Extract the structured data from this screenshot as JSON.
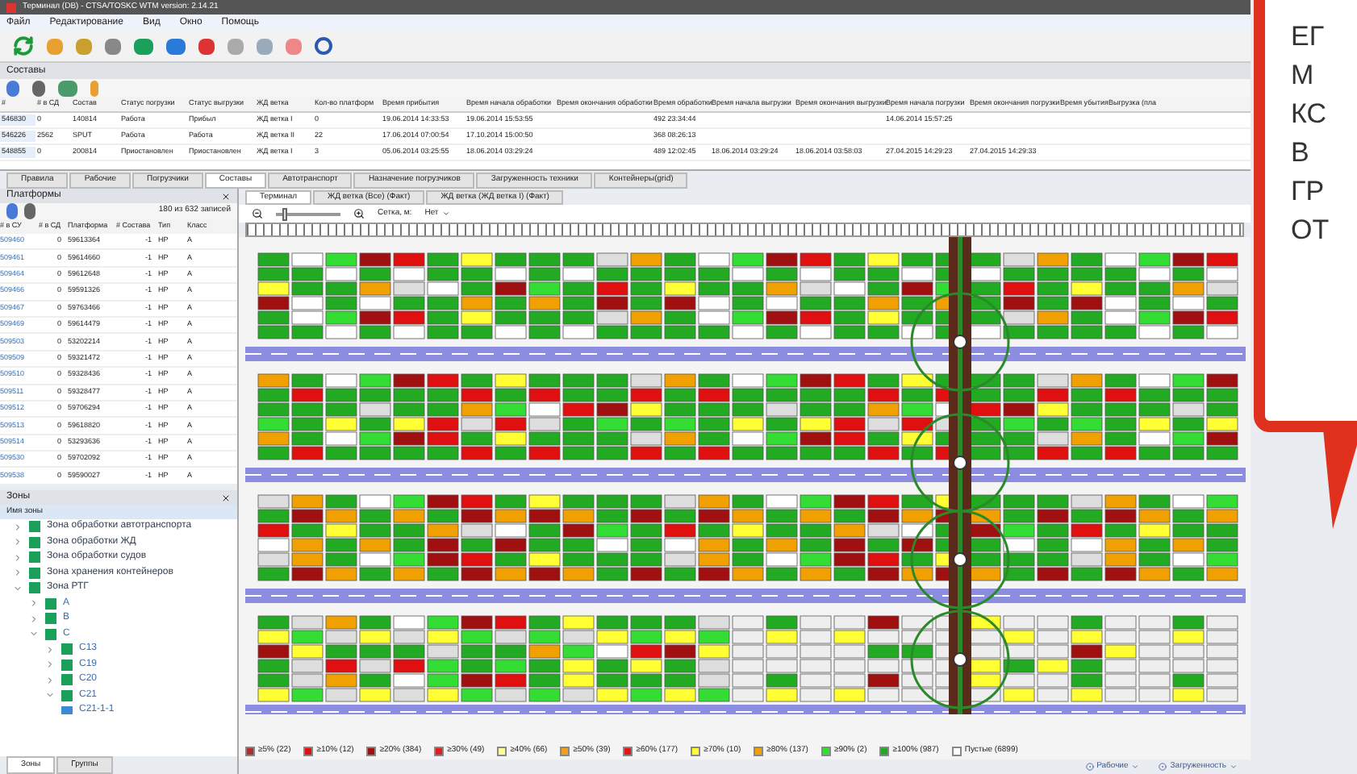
{
  "window": {
    "title": "Терминал (DB) - CTSA/TOSKC WTM version: 2.14.21"
  },
  "menu": [
    "Файл",
    "Редактирование",
    "Вид",
    "Окно",
    "Помощь"
  ],
  "trains": {
    "title": "Составы",
    "columns": [
      "#",
      "# в СД",
      "Состав",
      "Статус погрузки",
      "Статус выгрузки",
      "ЖД ветка",
      "Кол-во платформ",
      "Время прибытия",
      "Время начала обработки",
      "Время окончания обработки",
      "Время обработки",
      "Время начала выгрузки",
      "Время окончания выгрузки",
      "Время начала погрузки",
      "Время окончания погрузки",
      "Время убытия",
      "Выгрузка (пла"
    ],
    "rows": [
      [
        "546830",
        "0",
        "140814",
        "Работа",
        "Прибыл",
        "ЖД ветка I",
        "0",
        "19.06.2014 14:33:53",
        "19.06.2014 15:53:55",
        "",
        "492 23:34:44",
        "",
        "",
        "14.06.2014 15:57:25",
        "",
        "",
        ""
      ],
      [
        "546226",
        "2562",
        "SPUT",
        "Работа",
        "Работа",
        "ЖД ветка II",
        "22",
        "17.06.2014 07:00:54",
        "17.10.2014 15:00:50",
        "",
        "368 08:26:13",
        "",
        "",
        "",
        "",
        "",
        ""
      ],
      [
        "548855",
        "0",
        "200814",
        "Приостановлен",
        "Приостановлен",
        "ЖД ветка I",
        "3",
        "05.06.2014 03:25:55",
        "18.06.2014 03:29:24",
        "",
        "489 12:02:45",
        "18.06.2014 03:29:24",
        "18.06.2014 03:58:03",
        "27.04.2015 14:29:23",
        "27.04.2015 14:29:33",
        "",
        ""
      ]
    ]
  },
  "tabs": [
    {
      "label": "Правила",
      "selected": false
    },
    {
      "label": "Рабочие",
      "selected": false
    },
    {
      "label": "Погрузчики",
      "selected": false
    },
    {
      "label": "Составы",
      "selected": true
    },
    {
      "label": "Автотранспорт",
      "selected": false
    },
    {
      "label": "Назначение погрузчиков",
      "selected": false
    },
    {
      "label": "Загруженность техники",
      "selected": false
    },
    {
      "label": "Контейнеры(grid)",
      "selected": false
    }
  ],
  "platforms": {
    "title": "Платформы",
    "count": "180 из 632 записей",
    "columns": [
      "# в СУ",
      "# в СД",
      "Платформа",
      "# Состава",
      "Тип",
      "Класс"
    ],
    "rows": [
      [
        "509460",
        "0",
        "59613364",
        "-1",
        "НР",
        "А"
      ],
      [
        "509461",
        "0",
        "59614660",
        "-1",
        "НР",
        "А"
      ],
      [
        "509464",
        "0",
        "59612648",
        "-1",
        "НР",
        "А"
      ],
      [
        "509466",
        "0",
        "59591326",
        "-1",
        "НР",
        "А"
      ],
      [
        "509467",
        "0",
        "59763466",
        "-1",
        "НР",
        "А"
      ],
      [
        "509469",
        "0",
        "59614479",
        "-1",
        "НР",
        "А"
      ],
      [
        "509503",
        "0",
        "53202214",
        "-1",
        "НР",
        "А"
      ],
      [
        "509509",
        "0",
        "59321472",
        "-1",
        "НР",
        "А"
      ],
      [
        "509510",
        "0",
        "59328436",
        "-1",
        "НР",
        "А"
      ],
      [
        "509511",
        "0",
        "59328477",
        "-1",
        "НР",
        "А"
      ],
      [
        "509512",
        "0",
        "59706294",
        "-1",
        "НР",
        "А"
      ],
      [
        "509513",
        "0",
        "59618820",
        "-1",
        "НР",
        "А"
      ],
      [
        "509514",
        "0",
        "53293636",
        "-1",
        "НР",
        "А"
      ],
      [
        "509530",
        "0",
        "59702092",
        "-1",
        "НР",
        "А"
      ],
      [
        "509538",
        "0",
        "59590027",
        "-1",
        "НР",
        "А"
      ]
    ]
  },
  "zones": {
    "title": "Зоны",
    "column": "Имя зоны",
    "tree": [
      {
        "label": "Зона обработки автотранспорта",
        "expanded": false
      },
      {
        "label": "Зона обработки ЖД",
        "expanded": false
      },
      {
        "label": "Зона обработки судов",
        "expanded": false
      },
      {
        "label": "Зона хранения контейнеров",
        "expanded": false
      },
      {
        "label": "Зона РТГ",
        "expanded": true,
        "children": [
          {
            "label": "A",
            "expanded": false
          },
          {
            "label": "B",
            "expanded": false
          },
          {
            "label": "C",
            "expanded": true,
            "children": [
              {
                "label": "C13",
                "expanded": false
              },
              {
                "label": "C19",
                "expanded": false
              },
              {
                "label": "C20",
                "expanded": false
              },
              {
                "label": "C21",
                "expanded": true,
                "children": [
                  {
                    "label": "C21-1-1"
                  }
                ]
              }
            ]
          }
        ]
      }
    ],
    "tabs": [
      {
        "label": "Зоны",
        "selected": true
      },
      {
        "label": "Группы",
        "selected": false
      }
    ]
  },
  "map": {
    "tabs": [
      {
        "label": "Терминал",
        "selected": true
      },
      {
        "label": "ЖД ветка (Все) (Факт)",
        "selected": false
      },
      {
        "label": "ЖД ветка (ЖД ветка I) (Факт)",
        "selected": false
      }
    ],
    "zoom": {
      "level": 0.1
    },
    "grid_label": "Сетка, м:",
    "grid_value": "Нет",
    "legend": [
      {
        "label": "≥5% (22)",
        "color": "#a83232"
      },
      {
        "label": "≥10% (12)",
        "color": "#e01010"
      },
      {
        "label": "≥20% (384)",
        "color": "#a01010"
      },
      {
        "label": "≥30% (49)",
        "color": "#e02020"
      },
      {
        "label": "≥40% (66)",
        "color": "#ffff99"
      },
      {
        "label": "≥50% (39)",
        "color": "#f0a020"
      },
      {
        "label": "≥60% (177)",
        "color": "#e01818"
      },
      {
        "label": "≥70% (10)",
        "color": "#ffff33"
      },
      {
        "label": "≥80% (137)",
        "color": "#f0a000"
      },
      {
        "label": "≥90% (2)",
        "color": "#33dd33"
      },
      {
        "label": "≥100% (987)",
        "color": "#22aa22"
      },
      {
        "label": "Пустые (6899)",
        "color": "#ffffff"
      }
    ]
  },
  "status_bar": [
    "Рабочие",
    "Загруженность"
  ],
  "callout": [
    "ЕГ",
    "М",
    "КС",
    "В",
    "ГР",
    "ОТ"
  ]
}
